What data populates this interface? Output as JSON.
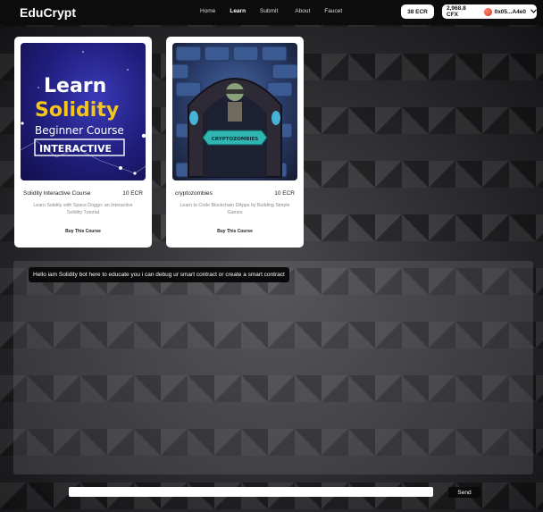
{
  "header": {
    "logo": "EduCrypt",
    "nav": [
      "Home",
      "Learn",
      "Submit",
      "About",
      "Faucet"
    ],
    "ecr_balance": "38 ECR",
    "cfx_balance": "2,968.8 CFX",
    "wallet_address": "0x05...A4e0"
  },
  "courses": [
    {
      "image_text": [
        "Learn",
        "Solidity",
        "Beginner Course",
        "INTERACTIVE"
      ],
      "title": "Solidity Interactive Course",
      "price": "10 ECR",
      "description": "Learn Solidity with Space Doggo: an Interactive Solidity Tutorial",
      "buy_label": "Buy This Course"
    },
    {
      "image_text": [
        "CRYPTOZOMBIES"
      ],
      "title": "cryptozombies",
      "price": "10 ECR",
      "description": "Learn to Code Blockchain DApps by Building Simple Games",
      "buy_label": "Buy This Course"
    }
  ],
  "chat": {
    "bot_message": "Hello iam Solidity bot here to educate you i can debug ur smart contract or create a smart contract",
    "input_value": "",
    "send_label": "Send"
  },
  "colors": {
    "header_bg": "#0c0c0d",
    "card_bg": "#ffffff",
    "bubble_bg": "#0a0a0b",
    "solidity_yellow": "#f5c518"
  }
}
